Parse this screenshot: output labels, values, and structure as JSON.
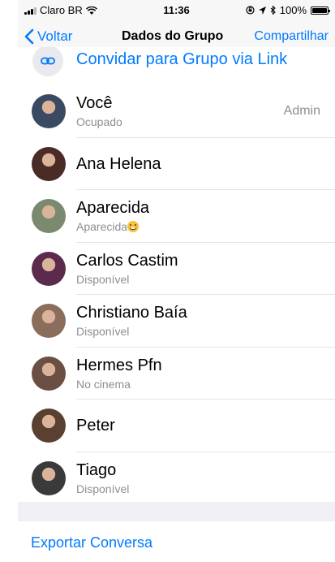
{
  "status_bar": {
    "carrier": "Claro BR",
    "time": "11:36",
    "battery": "100%",
    "battery_level": 1.0,
    "icons": [
      "signal-icon",
      "wifi-icon",
      "orientation-lock-icon",
      "location-icon",
      "bluetooth-icon",
      "battery-icon"
    ]
  },
  "nav": {
    "back_label": "Voltar",
    "title": "Dados do Grupo",
    "action_label": "Compartilhar"
  },
  "invite": {
    "label": "Convidar para Grupo via Link",
    "icon": "link-icon"
  },
  "members": [
    {
      "name": "Você",
      "status": "Ocupado",
      "badge": "Admin",
      "avatar_color": "#3b4a63"
    },
    {
      "name": "Ana Helena",
      "status": "",
      "badge": "",
      "avatar_color": "#4a2b25"
    },
    {
      "name": "Aparecida",
      "status": "Aparecida",
      "status_emoji": "grinning-face-emoji",
      "badge": "",
      "avatar_color": "#7b8a6f"
    },
    {
      "name": "Carlos Castim",
      "status": "Disponível",
      "badge": "",
      "avatar_color": "#5c2a4d"
    },
    {
      "name": "Christiano Baía",
      "status": "Disponível",
      "badge": "",
      "avatar_color": "#8a6d5a"
    },
    {
      "name": "Hermes Pfn",
      "status": "No cinema",
      "badge": "",
      "avatar_color": "#6b4f43"
    },
    {
      "name": "Peter",
      "status": "",
      "badge": "",
      "avatar_color": "#5a4030"
    },
    {
      "name": "Tiago",
      "status": "Disponível",
      "badge": "",
      "avatar_color": "#3a3a3a"
    }
  ],
  "export_label": "Exportar Conversa",
  "colors": {
    "accent": "#007aff",
    "secondary_text": "#8e8e93",
    "bar_background": "#f7f7f8",
    "group_background": "#efeff4"
  }
}
